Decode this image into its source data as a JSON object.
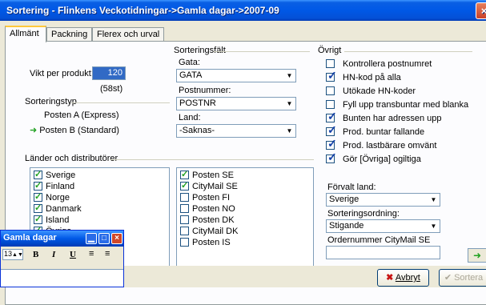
{
  "window": {
    "title": "Sortering - Flinkens Veckotidningar->Gamla dagar->2007-09",
    "close_glyph": "×"
  },
  "tabs": [
    {
      "label": "Allmänt",
      "active": true
    },
    {
      "label": "Packning",
      "active": false
    },
    {
      "label": "Flerex och urval",
      "active": false
    }
  ],
  "vikt": {
    "label": "Vikt per produkt:",
    "value": "120",
    "count": "(58st)"
  },
  "sorteringstyp": {
    "label": "Sorteringstyp",
    "options": [
      {
        "label": "Posten A (Express)",
        "selected": false
      },
      {
        "label": "Posten B (Standard)",
        "selected": true
      }
    ]
  },
  "sorteringsfalt": {
    "label": "Sorteringsfält",
    "gata": {
      "label": "Gata:",
      "value": "GATA"
    },
    "postnummer": {
      "label": "Postnummer:",
      "value": "POSTNR"
    },
    "land": {
      "label": "Land:",
      "value": "-Saknas-"
    }
  },
  "ovrigt": {
    "label": "Övrigt",
    "items": [
      {
        "label": "Kontrollera postnumret",
        "checked": false
      },
      {
        "label": "HN-kod på alla",
        "checked": true
      },
      {
        "label": "Utökade HN-koder",
        "checked": false
      },
      {
        "label": "Fyll upp transbuntar med blanka",
        "checked": false
      },
      {
        "label": "Bunten har adressen upp",
        "checked": true
      },
      {
        "label": "Prod. buntar fallande",
        "checked": true
      },
      {
        "label": "Prod. lastbärare omvänt",
        "checked": true
      },
      {
        "label": "Gör [Övriga] ogiltiga",
        "checked": true
      }
    ]
  },
  "lander": {
    "label": "Länder och distributörer",
    "countries": [
      {
        "label": "Sverige",
        "checked": true
      },
      {
        "label": "Finland",
        "checked": true
      },
      {
        "label": "Norge",
        "checked": true
      },
      {
        "label": "Danmark",
        "checked": true
      },
      {
        "label": "Island",
        "checked": true
      },
      {
        "label": "Övriga",
        "checked": true
      }
    ],
    "distributors": [
      {
        "label": "Posten SE",
        "checked": true
      },
      {
        "label": "CityMail SE",
        "checked": true
      },
      {
        "label": "Posten FI",
        "checked": false
      },
      {
        "label": "Posten NO",
        "checked": false
      },
      {
        "label": "Posten DK",
        "checked": false
      },
      {
        "label": "CityMail DK",
        "checked": false
      },
      {
        "label": "Posten IS",
        "checked": false
      }
    ]
  },
  "forvalt_land": {
    "label": "Förvalt land:",
    "value": "Sverige"
  },
  "sorteringsordning": {
    "label": "Sorteringsordning:",
    "value": "Stigande"
  },
  "ordernummer": {
    "label": "Ordernummer CityMail SE",
    "value": ""
  },
  "buttons": {
    "avbryt": "Avbryt",
    "sortera": "Sortera"
  },
  "float_window": {
    "title": "Gamla dagar",
    "font_size": "13"
  },
  "colors": {
    "titlebar": "#0058e6",
    "arrow_green": "#21a121",
    "tab_accent": "#ffc83c"
  }
}
